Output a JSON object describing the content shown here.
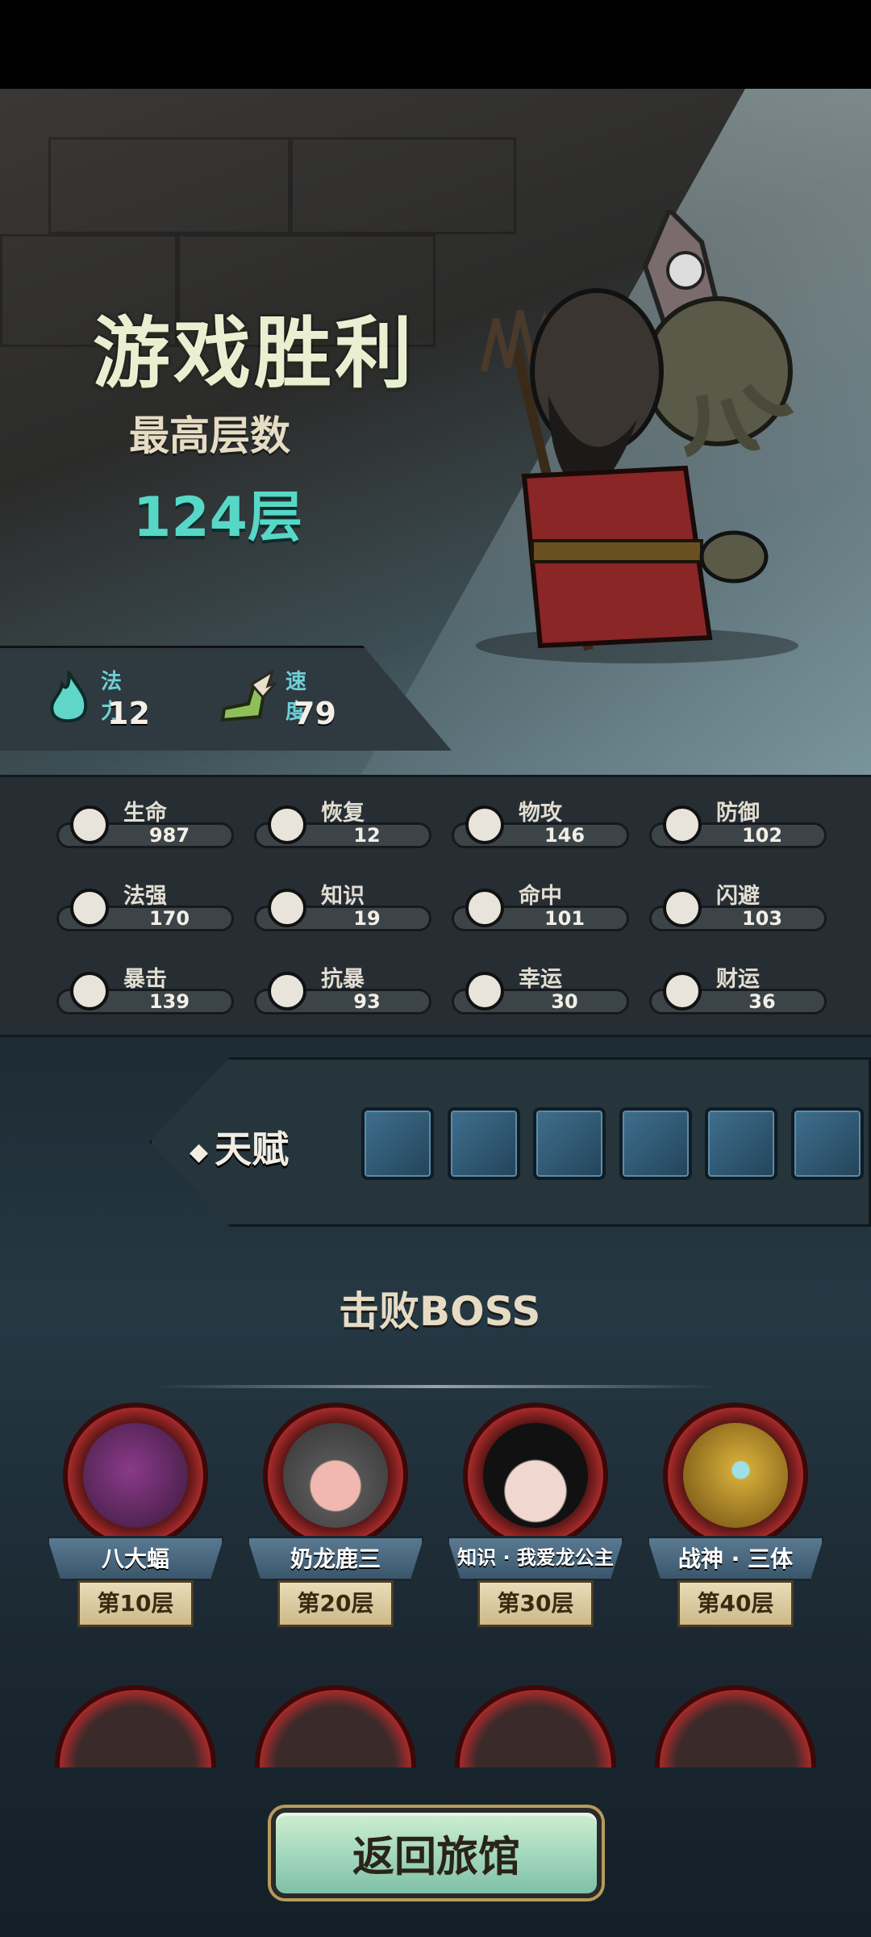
{
  "result": {
    "title": "游戏胜利",
    "highest_floor_label": "最高层数",
    "highest_floor_value": "124层"
  },
  "mini_stats": [
    {
      "label": "法力",
      "value": "12",
      "icon": "mana-flame-icon"
    },
    {
      "label": "速度",
      "value": "79",
      "icon": "winged-boot-icon"
    }
  ],
  "stats": [
    {
      "label": "生命",
      "value": "987",
      "icon": "heart-icon"
    },
    {
      "label": "恢复",
      "value": "12",
      "icon": "heal-heart-icon"
    },
    {
      "label": "物攻",
      "value": "146",
      "icon": "sword-icon"
    },
    {
      "label": "防御",
      "value": "102",
      "icon": "armor-icon"
    },
    {
      "label": "法强",
      "value": "170",
      "icon": "magic-staff-icon"
    },
    {
      "label": "知识",
      "value": "19",
      "icon": "book-icon"
    },
    {
      "label": "命中",
      "value": "101",
      "icon": "target-icon"
    },
    {
      "label": "闪避",
      "value": "103",
      "icon": "dodge-arrows-icon"
    },
    {
      "label": "暴击",
      "value": "139",
      "icon": "crit-dagger-icon"
    },
    {
      "label": "抗暴",
      "value": "93",
      "icon": "shield-wings-icon"
    },
    {
      "label": "幸运",
      "value": "30",
      "icon": "clover-icon"
    },
    {
      "label": "财运",
      "value": "36",
      "icon": "coin-icon"
    }
  ],
  "talents": {
    "label": "天赋",
    "slots": [
      "portal-ring-icon",
      "bow-icon",
      "pig-icon",
      "mask-icon",
      "crossed-pistols-icon",
      "skull-creature-icon"
    ]
  },
  "bosses": {
    "title": "击败BOSS",
    "items": [
      {
        "name": "八大蝠",
        "floor": "第10层",
        "color": "#6a2a6a"
      },
      {
        "name": "奶龙鹿三",
        "floor": "第20层",
        "color": "#555"
      },
      {
        "name": "知识 · 我爱龙公主",
        "floor": "第30层",
        "color": "#e8c8c0"
      },
      {
        "name": "战神 · 三体",
        "floor": "第40层",
        "color": "#b8902a"
      }
    ]
  },
  "return_button": "返回旅馆"
}
